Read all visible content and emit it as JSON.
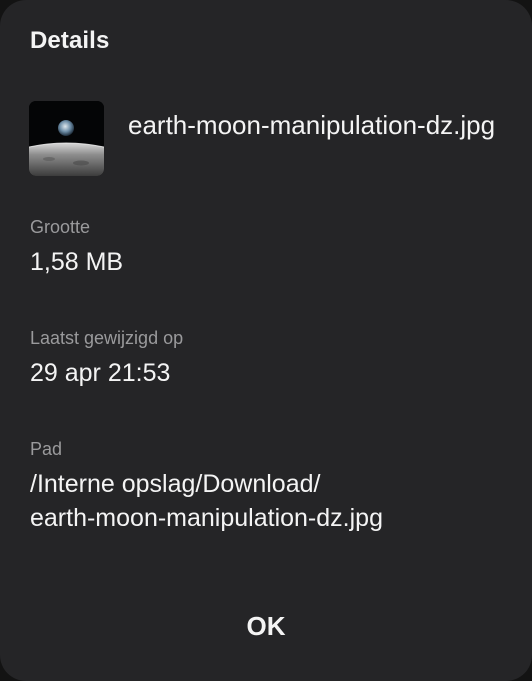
{
  "dialog": {
    "title": "Details",
    "file_name": "earth-moon-manipulation-dz.jpg",
    "thumbnail_icon": "earth-moon-image-thumbnail",
    "fields": {
      "size": {
        "label": "Grootte",
        "value": "1,58 MB"
      },
      "modified": {
        "label": "Laatst gewijzigd op",
        "value": "29 apr 21:53"
      },
      "path": {
        "label": "Pad",
        "value": "/Interne opslag/Download/\nearth-moon-manipulation-dz.jpg"
      }
    },
    "ok_label": "OK"
  },
  "colors": {
    "dialog_background": "#252527",
    "text_primary": "#f4f4f4",
    "text_secondary": "#9a9a9c"
  }
}
